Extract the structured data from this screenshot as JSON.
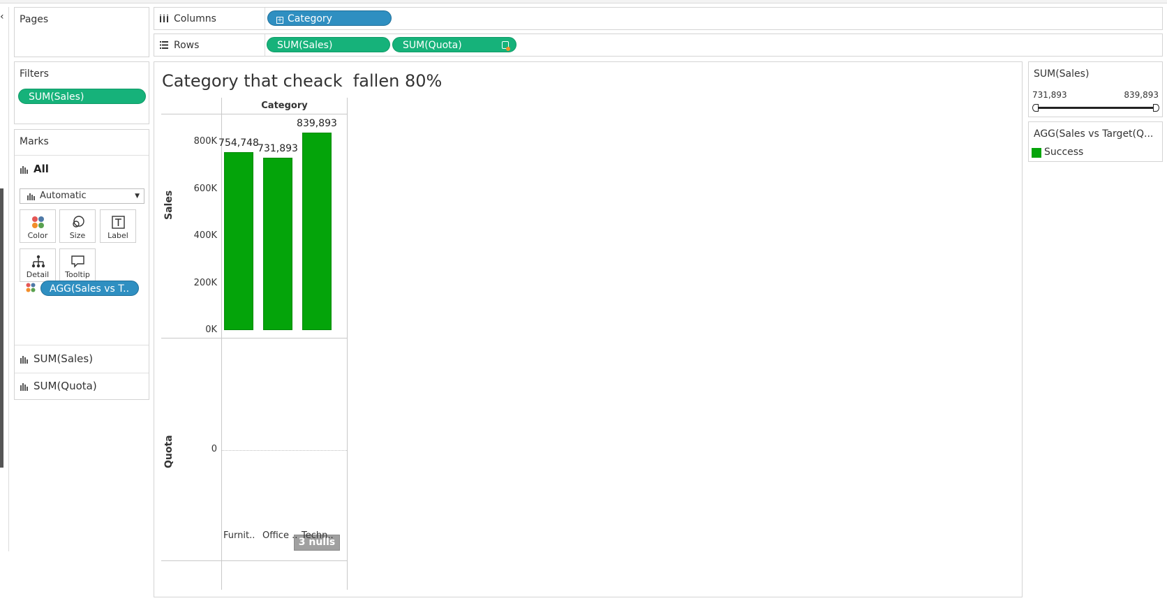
{
  "pages": {
    "title": "Pages"
  },
  "filters": {
    "title": "Filters",
    "pill": "SUM(Sales)"
  },
  "marks": {
    "title": "Marks",
    "all_label": "All",
    "mark_type": "Automatic",
    "buttons": {
      "color": "Color",
      "size": "Size",
      "label": "Label",
      "detail": "Detail",
      "tooltip": "Tooltip"
    },
    "color_pill": "AGG(Sales vs T..",
    "sections": [
      "SUM(Sales)",
      "SUM(Quota)"
    ]
  },
  "shelves": {
    "columns_label": "Columns",
    "columns_pill": "Category",
    "rows_label": "Rows",
    "rows_pills": [
      "SUM(Sales)",
      "SUM(Quota)"
    ]
  },
  "view": {
    "title": "Category that cheack  fallen 80%",
    "header": "Category",
    "nulls_badge": "3 nulls",
    "quota_zero": "0"
  },
  "legend_sales": {
    "title": "SUM(Sales)",
    "min": "731,893",
    "max": "839,893"
  },
  "legend_color": {
    "title": "AGG(Sales vs Target(Q...",
    "item": "Success",
    "color": "#04a40a"
  },
  "chart_data": {
    "type": "bar",
    "categories": [
      "Furnit..",
      "Office ..",
      "Techn.."
    ],
    "series": [
      {
        "values": [
          754748,
          731893,
          839893
        ]
      }
    ],
    "value_labels": [
      "754,748",
      "731,893",
      "839,893"
    ],
    "ylabel": "Sales",
    "ylabel2": "Quota",
    "yticks": [
      "800K",
      "600K",
      "400K",
      "200K",
      "0K"
    ],
    "ytick_values": [
      800000,
      600000,
      400000,
      200000,
      0
    ],
    "ylim": [
      0,
      900000
    ],
    "xlabel": "Category",
    "bar_color": "#04a40a"
  }
}
